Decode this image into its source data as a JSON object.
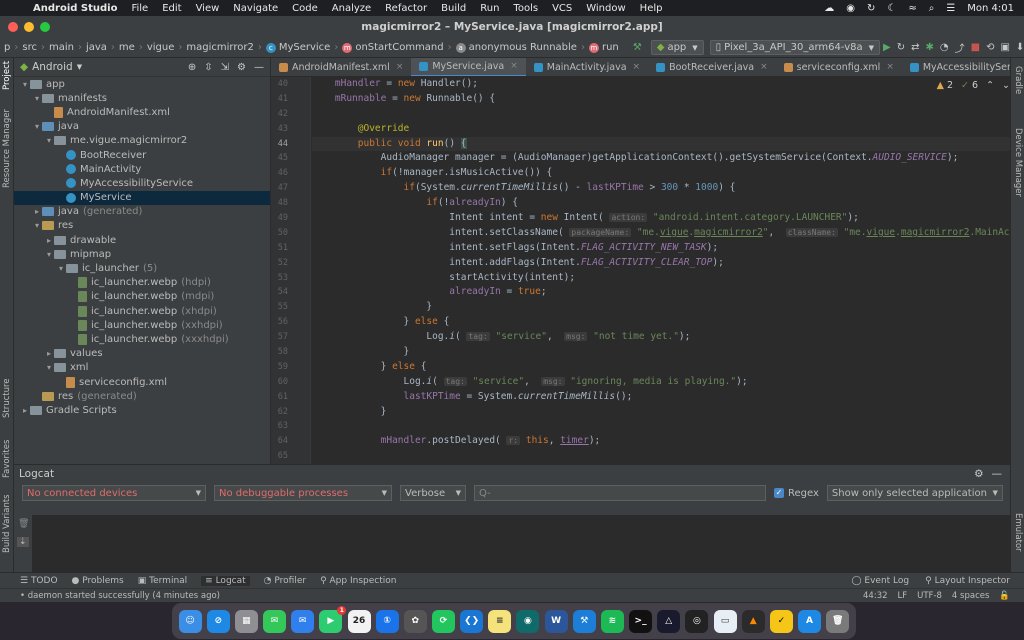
{
  "menubar": {
    "app_name": "Android Studio",
    "items": [
      "File",
      "Edit",
      "View",
      "Navigate",
      "Code",
      "Analyze",
      "Refactor",
      "Build",
      "Run",
      "Tools",
      "VCS",
      "Window",
      "Help"
    ],
    "clock": "Mon 4:01"
  },
  "window": {
    "title": "magicmirror2 – MyService.java [magicmirror2.app]"
  },
  "breadcrumb": [
    "p",
    "src",
    "main",
    "java",
    "me",
    "vigue",
    "magicmirror2",
    "MyService",
    "onStartCommand",
    "anonymous Runnable",
    "run"
  ],
  "run_config": {
    "module": "app",
    "device": "Pixel_3a_API_30_arm64-v8a"
  },
  "project": {
    "header": "Android",
    "rows": [
      {
        "label": "app",
        "indent": 0,
        "arrow": "▾",
        "icon": "folder"
      },
      {
        "label": "manifests",
        "indent": 1,
        "arrow": "▾",
        "icon": "folder"
      },
      {
        "label": "AndroidManifest.xml",
        "indent": 2,
        "arrow": "",
        "icon": "xml"
      },
      {
        "label": "java",
        "indent": 1,
        "arrow": "▾",
        "icon": "src"
      },
      {
        "label": "me.vigue.magicmirror2",
        "indent": 2,
        "arrow": "▾",
        "icon": "folder"
      },
      {
        "label": "BootReceiver",
        "indent": 3,
        "arrow": "",
        "icon": "class"
      },
      {
        "label": "MainActivity",
        "indent": 3,
        "arrow": "",
        "icon": "class"
      },
      {
        "label": "MyAccessibilityService",
        "indent": 3,
        "arrow": "",
        "icon": "class"
      },
      {
        "label": "MyService",
        "indent": 3,
        "arrow": "",
        "icon": "class",
        "selected": true
      },
      {
        "label": "java",
        "suffix": "(generated)",
        "indent": 1,
        "arrow": "▸",
        "icon": "src"
      },
      {
        "label": "res",
        "indent": 1,
        "arrow": "▾",
        "icon": "res"
      },
      {
        "label": "drawable",
        "indent": 2,
        "arrow": "▸",
        "icon": "folder"
      },
      {
        "label": "mipmap",
        "indent": 2,
        "arrow": "▾",
        "icon": "folder"
      },
      {
        "label": "ic_launcher",
        "suffix": "(5)",
        "indent": 3,
        "arrow": "▾",
        "icon": "folder"
      },
      {
        "label": "ic_launcher.webp",
        "suffix": "(hdpi)",
        "indent": 4,
        "arrow": "",
        "icon": "img"
      },
      {
        "label": "ic_launcher.webp",
        "suffix": "(mdpi)",
        "indent": 4,
        "arrow": "",
        "icon": "img"
      },
      {
        "label": "ic_launcher.webp",
        "suffix": "(xhdpi)",
        "indent": 4,
        "arrow": "",
        "icon": "img"
      },
      {
        "label": "ic_launcher.webp",
        "suffix": "(xxhdpi)",
        "indent": 4,
        "arrow": "",
        "icon": "img"
      },
      {
        "label": "ic_launcher.webp",
        "suffix": "(xxxhdpi)",
        "indent": 4,
        "arrow": "",
        "icon": "img"
      },
      {
        "label": "values",
        "indent": 2,
        "arrow": "▸",
        "icon": "folder"
      },
      {
        "label": "xml",
        "indent": 2,
        "arrow": "▾",
        "icon": "folder"
      },
      {
        "label": "serviceconfig.xml",
        "indent": 3,
        "arrow": "",
        "icon": "xml"
      },
      {
        "label": "res",
        "suffix": "(generated)",
        "indent": 1,
        "arrow": "",
        "icon": "res"
      },
      {
        "label": "Gradle Scripts",
        "indent": 0,
        "arrow": "▸",
        "icon": "gradle"
      }
    ]
  },
  "tabs": [
    {
      "label": "AndroidManifest.xml",
      "color": "#c78b4c"
    },
    {
      "label": "MyService.java",
      "color": "#3592c4",
      "active": true
    },
    {
      "label": "MainActivity.java",
      "color": "#3592c4"
    },
    {
      "label": "BootReceiver.java",
      "color": "#3592c4"
    },
    {
      "label": "serviceconfig.xml",
      "color": "#c78b4c"
    },
    {
      "label": "MyAccessibilityService.java",
      "color": "#3592c4"
    }
  ],
  "inspections": {
    "warnings": "2",
    "weak": "6"
  },
  "line_numbers": [
    "40",
    "41",
    "42",
    "43",
    "44",
    "45",
    "46",
    "47",
    "48",
    "49",
    "50",
    "51",
    "52",
    "53",
    "54",
    "55",
    "56",
    "57",
    "58",
    "59",
    "60",
    "61",
    "62",
    "63",
    "64",
    "65"
  ],
  "logcat": {
    "title": "Logcat",
    "device": "No connected devices",
    "process": "No debuggable processes",
    "level": "Verbose",
    "search_placeholder": "Q-",
    "regex": "Regex",
    "filter": "Show only selected application"
  },
  "bottom_tools": [
    "TODO",
    "Problems",
    "Terminal",
    "Logcat",
    "Profiler",
    "App Inspection"
  ],
  "bottom_right": [
    "Event Log",
    "Layout Inspector"
  ],
  "status": {
    "message": "• daemon started successfully (4 minutes ago)",
    "position": "44:32",
    "line_sep": "LF",
    "encoding": "UTF-8",
    "indent": "4 spaces"
  },
  "left_strip": [
    "Project",
    "Resource Manager",
    "Structure",
    "Favorites",
    "Build Variants"
  ],
  "right_strip": [
    "Gradle",
    "Device Manager",
    "Emulator"
  ],
  "dock": [
    {
      "name": "finder",
      "color": "#3a8ee6",
      "glyph": "☺"
    },
    {
      "name": "safari",
      "color": "#1e88e5",
      "glyph": "⊘"
    },
    {
      "name": "launchpad",
      "color": "#8e8e93",
      "glyph": "▦"
    },
    {
      "name": "messages",
      "color": "#34c759",
      "glyph": "✉"
    },
    {
      "name": "mail",
      "color": "#2f80ed",
      "glyph": "✉"
    },
    {
      "name": "facetime",
      "color": "#2ecc71",
      "glyph": "▶",
      "badge": "1"
    },
    {
      "name": "calendar",
      "color": "#f2f2f2",
      "glyph": "26",
      "text": "#222"
    },
    {
      "name": "1password",
      "color": "#1a73e8",
      "glyph": "①"
    },
    {
      "name": "chatgpt",
      "color": "#555",
      "glyph": "✿"
    },
    {
      "name": "pycharm",
      "color": "#22c55e",
      "glyph": "⟳"
    },
    {
      "name": "vscode",
      "color": "#1976d2",
      "glyph": "❮❯"
    },
    {
      "name": "notes",
      "color": "#f5e27a",
      "glyph": "≡",
      "text": "#333"
    },
    {
      "name": "gitkraken",
      "color": "#106a6a",
      "glyph": "◉"
    },
    {
      "name": "word",
      "color": "#2b579a",
      "glyph": "W"
    },
    {
      "name": "xcode",
      "color": "#1c7ed6",
      "glyph": "⚒"
    },
    {
      "name": "spotify",
      "color": "#1db954",
      "glyph": "≋"
    },
    {
      "name": "terminal",
      "color": "#111",
      "glyph": ">_"
    },
    {
      "name": "affinity",
      "color": "#1a1a2e",
      "glyph": "△"
    },
    {
      "name": "network",
      "color": "#222",
      "glyph": "◎"
    },
    {
      "name": "preview",
      "color": "#e8eef5",
      "glyph": "▭",
      "text": "#333"
    },
    {
      "name": "vlc",
      "color": "#2b2b2b",
      "glyph": "▲",
      "text": "#ff8800"
    },
    {
      "name": "norton",
      "color": "#f5c518",
      "glyph": "✓",
      "text": "#000"
    },
    {
      "name": "appstore",
      "color": "#1e88e5",
      "glyph": "A"
    },
    {
      "name": "trash",
      "color": "#7a7a7a",
      "glyph": "🗑"
    }
  ]
}
